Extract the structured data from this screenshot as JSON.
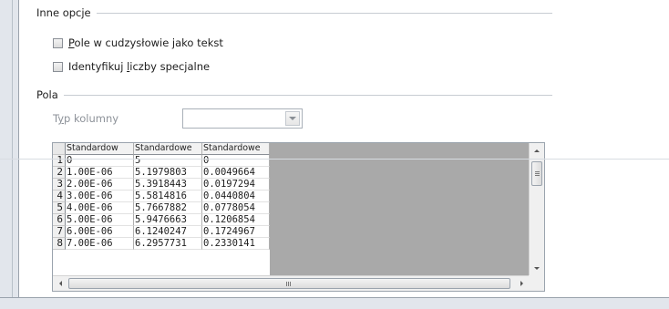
{
  "other_options": {
    "title": "Inne opcje",
    "quoted_as_text": {
      "prefix": "",
      "accel": "P",
      "rest": "ole w cudzysłowie jako tekst"
    },
    "detect_special_numbers": {
      "prefix": "Identyfikuj ",
      "accel": "l",
      "rest": "iczby specjalne"
    }
  },
  "fields": {
    "title": "Pola",
    "column_type_label": {
      "prefix": "T",
      "accel": "y",
      "rest": "p kolumny"
    },
    "column_type_value": ""
  },
  "grid": {
    "headers": [
      "Standardow",
      "Standardowe",
      "Standardowe"
    ],
    "rows": [
      {
        "n": "1",
        "cells": [
          "0",
          "5",
          "0"
        ]
      },
      {
        "n": "2",
        "cells": [
          "1.00E-06",
          "5.1979803",
          "0.0049664"
        ]
      },
      {
        "n": "3",
        "cells": [
          "2.00E-06",
          "5.3918443",
          "0.0197294"
        ]
      },
      {
        "n": "4",
        "cells": [
          "3.00E-06",
          "5.5814816",
          "0.0440804"
        ]
      },
      {
        "n": "5",
        "cells": [
          "4.00E-06",
          "5.7667882",
          "0.0778054"
        ]
      },
      {
        "n": "6",
        "cells": [
          "5.00E-06",
          "5.9476663",
          "0.1206854"
        ]
      },
      {
        "n": "7",
        "cells": [
          "6.00E-06",
          "6.1240247",
          "0.1724967"
        ]
      },
      {
        "n": "8",
        "cells": [
          "7.00E-06",
          "6.2957731",
          "0.2330141"
        ]
      }
    ]
  },
  "icons": {
    "checkbox": "checkbox-unchecked",
    "dropdown": "chevron-down-icon",
    "scroll_up": "triangle-up",
    "scroll_down": "triangle-down",
    "scroll_left": "triangle-left",
    "scroll_right": "triangle-right"
  }
}
